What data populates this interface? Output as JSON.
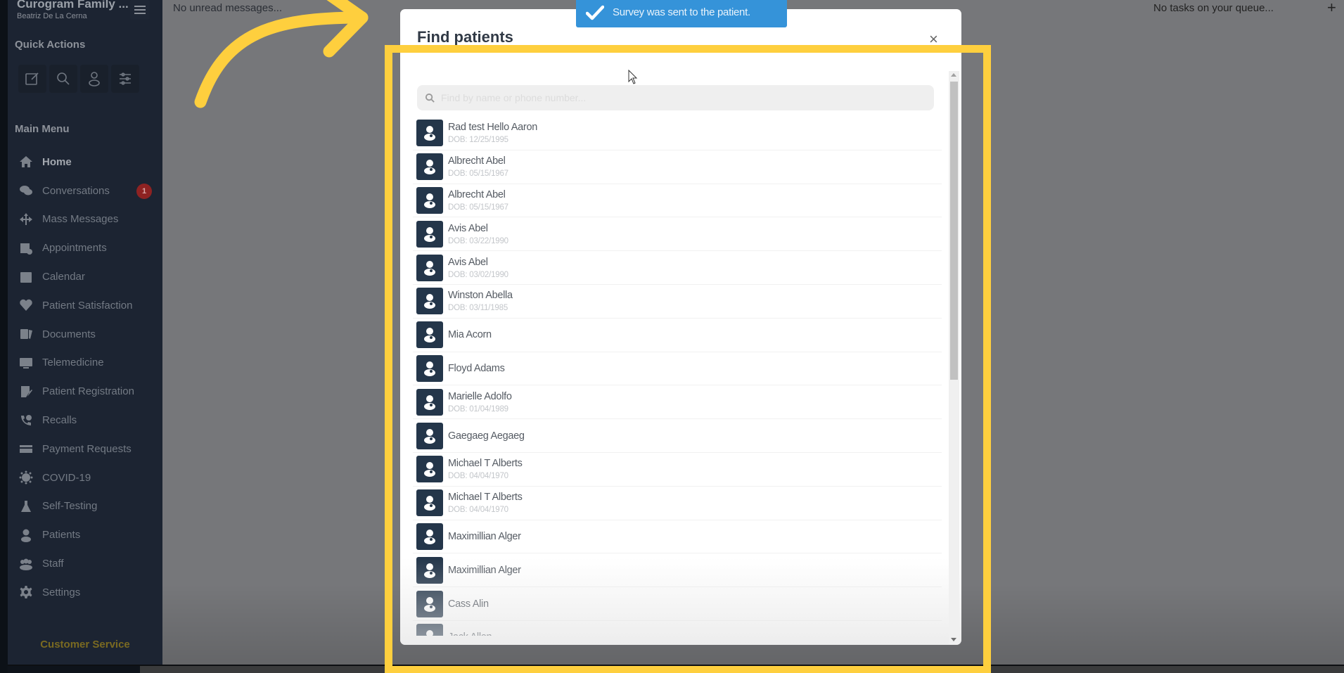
{
  "app": {
    "org_name": "Curogram Family ...",
    "user_name": "Beatriz De La Cerna"
  },
  "sidebar": {
    "menu_icon": "hamburger-icon",
    "quick_actions_title": "Quick Actions",
    "quick_actions": [
      {
        "name": "compose",
        "icon": "edit-icon"
      },
      {
        "name": "search",
        "icon": "search-icon"
      },
      {
        "name": "patient",
        "icon": "patient-icon"
      },
      {
        "name": "settings",
        "icon": "sliders-icon"
      }
    ],
    "main_menu_title": "Main Menu",
    "items": [
      {
        "label": "Home",
        "icon": "home-icon",
        "active": true
      },
      {
        "label": "Conversations",
        "icon": "chat-icon",
        "badge": "1"
      },
      {
        "label": "Mass Messages",
        "icon": "broadcast-icon"
      },
      {
        "label": "Appointments",
        "icon": "appointments-icon"
      },
      {
        "label": "Calendar",
        "icon": "calendar-icon"
      },
      {
        "label": "Patient Satisfaction",
        "icon": "heart-icon"
      },
      {
        "label": "Documents",
        "icon": "documents-icon"
      },
      {
        "label": "Telemedicine",
        "icon": "telemedicine-icon"
      },
      {
        "label": "Patient Registration",
        "icon": "registration-icon"
      },
      {
        "label": "Recalls",
        "icon": "recalls-icon"
      },
      {
        "label": "Payment Requests",
        "icon": "credit-card-icon"
      },
      {
        "label": "COVID-19",
        "icon": "virus-icon"
      },
      {
        "label": "Self-Testing",
        "icon": "flask-icon"
      },
      {
        "label": "Patients",
        "icon": "patient-icon"
      },
      {
        "label": "Staff",
        "icon": "staff-icon"
      },
      {
        "label": "Settings",
        "icon": "gear-icon"
      }
    ],
    "customer_service": "Customer Service"
  },
  "header": {
    "messages_status": "No unread messages...",
    "tasks_status": "No tasks on your queue...",
    "add_label": "+"
  },
  "toast": {
    "message": "Survey was sent to the patient.",
    "icon": "check-icon",
    "color": "#3593d9"
  },
  "modal": {
    "title": "Find patients",
    "close_label": "×",
    "search": {
      "placeholder": "Find by name or phone number...",
      "value": ""
    },
    "patients": [
      {
        "name": "Rad test Hello Aaron",
        "dob": "DOB: 12/25/1995"
      },
      {
        "name": "Albrecht Abel",
        "dob": "DOB: 05/15/1967"
      },
      {
        "name": "Albrecht Abel",
        "dob": "DOB: 05/15/1967"
      },
      {
        "name": "Avis Abel",
        "dob": "DOB: 03/22/1990"
      },
      {
        "name": "Avis Abel",
        "dob": "DOB: 03/02/1990"
      },
      {
        "name": "Winston Abella",
        "dob": "DOB: 03/11/1985"
      },
      {
        "name": "Mia Acorn",
        "dob": ""
      },
      {
        "name": "Floyd Adams",
        "dob": ""
      },
      {
        "name": "Marielle Adolfo",
        "dob": "DOB: 01/04/1989"
      },
      {
        "name": "Gaegaeg Aegaeg",
        "dob": ""
      },
      {
        "name": "Michael T Alberts",
        "dob": "DOB: 04/04/1970"
      },
      {
        "name": "Michael T Alberts",
        "dob": "DOB: 04/04/1970"
      },
      {
        "name": "Maximillian Alger",
        "dob": ""
      },
      {
        "name": "Maximillian Alger",
        "dob": ""
      },
      {
        "name": "Cass Alin",
        "dob": ""
      },
      {
        "name": "Jack Allen",
        "dob": ""
      }
    ]
  },
  "annotation": {
    "highlight_color": "#fecf3e"
  }
}
